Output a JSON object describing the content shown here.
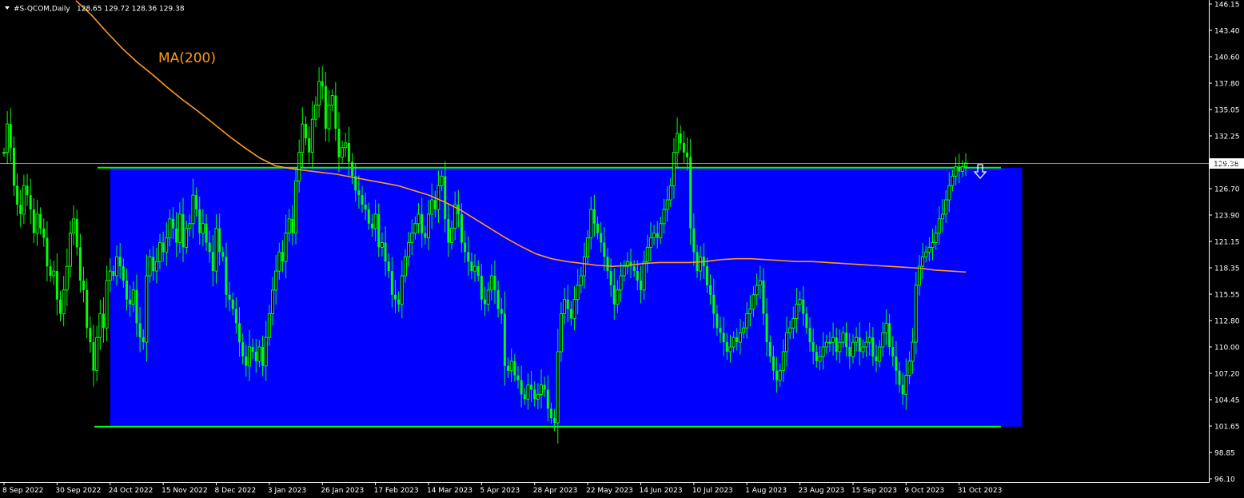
{
  "header": {
    "symbol": "#S-QCOM,Daily",
    "ohlc": "128.65 129.72 128.36 129.38"
  },
  "colors": {
    "background": "#000000",
    "axis": "#ffffff",
    "candle": "#00ff00",
    "channel_fill": "#0000ff",
    "channel_line": "#00ff00",
    "ma_line": "#ff9a1e",
    "price_line": "#c0c0c0"
  },
  "chart_data": {
    "type": "candlestick",
    "ma_label": "MA(200)",
    "current_price": 129.38,
    "current_price_label": "129.38",
    "ylim": [
      96.1,
      146.15
    ],
    "y_ticks": [
      "146.15",
      "143.40",
      "140.60",
      "137.80",
      "135.05",
      "132.25",
      "129.45",
      "126.70",
      "123.90",
      "121.15",
      "118.35",
      "115.55",
      "112.80",
      "110.00",
      "107.20",
      "104.45",
      "101.65",
      "98.85",
      "96.10"
    ],
    "x_ticks": [
      "8 Sep 2022",
      "30 Sep 2022",
      "24 Oct 2022",
      "15 Nov 2022",
      "8 Dec 2022",
      "3 Jan 2023",
      "26 Jan 2023",
      "17 Feb 2023",
      "14 Mar 2023",
      "5 Apr 2023",
      "28 Apr 2023",
      "22 May 2023",
      "14 Jun 2023",
      "10 Jul 2023",
      "1 Aug 2023",
      "23 Aug 2023",
      "15 Sep 2023",
      "9 Oct 2023",
      "31 Oct 2023"
    ],
    "x_tick_bar_index": [
      0,
      16,
      32,
      48,
      64,
      80,
      96,
      112,
      128,
      144,
      160,
      176,
      192,
      208,
      224,
      240,
      256,
      272,
      288
    ],
    "channel": {
      "upper": 128.9,
      "lower": 101.6,
      "start_bar": 32,
      "end_bar": 307
    },
    "bars_total": 302,
    "close": [
      130.5,
      133.5,
      131.0,
      127.0,
      125.0,
      124.0,
      127.0,
      126.0,
      124.5,
      122.0,
      124.0,
      122.5,
      121.5,
      118.5,
      117.5,
      118.0,
      115.0,
      113.5,
      116.0,
      118.5,
      122.0,
      123.5,
      120.5,
      117.0,
      116.0,
      112.0,
      110.5,
      107.5,
      111.0,
      113.5,
      112.0,
      117.0,
      118.0,
      117.5,
      119.5,
      118.5,
      117.0,
      115.0,
      114.5,
      116.0,
      112.5,
      111.0,
      110.5,
      117.5,
      119.5,
      118.0,
      119.0,
      121.0,
      120.0,
      121.5,
      123.5,
      122.5,
      121.0,
      124.0,
      120.5,
      122.5,
      123.0,
      126.0,
      124.5,
      122.0,
      123.0,
      121.0,
      120.0,
      118.0,
      122.5,
      120.0,
      119.5,
      115.5,
      115.0,
      114.0,
      112.5,
      110.5,
      109.0,
      108.0,
      110.0,
      109.5,
      108.5,
      110.0,
      108.0,
      111.0,
      113.5,
      116.0,
      118.0,
      120.0,
      119.0,
      122.0,
      123.5,
      122.0,
      127.5,
      130.5,
      133.5,
      132.0,
      130.5,
      134.0,
      135.5,
      138.0,
      137.5,
      133.0,
      135.5,
      136.5,
      133.0,
      130.0,
      131.0,
      131.5,
      129.5,
      128.0,
      126.5,
      126.0,
      125.0,
      124.5,
      123.0,
      122.5,
      124.0,
      120.5,
      121.0,
      119.0,
      118.0,
      115.5,
      115.0,
      114.5,
      117.5,
      119.5,
      121.0,
      122.0,
      123.0,
      124.0,
      122.0,
      121.5,
      124.0,
      125.5,
      124.5,
      127.0,
      128.0,
      123.5,
      121.0,
      122.5,
      125.0,
      124.0,
      121.0,
      120.0,
      119.0,
      118.0,
      118.5,
      117.5,
      115.0,
      114.5,
      116.0,
      117.5,
      116.0,
      114.0,
      113.5,
      108.0,
      107.5,
      108.5,
      107.0,
      106.5,
      105.0,
      104.5,
      106.0,
      105.5,
      104.5,
      105.0,
      106.0,
      105.5,
      103.5,
      102.5,
      102.0,
      109.5,
      113.5,
      115.0,
      114.0,
      113.0,
      115.0,
      116.5,
      117.5,
      119.5,
      121.5,
      124.5,
      123.0,
      122.0,
      121.0,
      119.5,
      118.0,
      116.5,
      114.5,
      116.0,
      117.5,
      118.5,
      119.0,
      118.5,
      118.0,
      117.0,
      116.0,
      119.0,
      120.5,
      121.5,
      122.0,
      121.5,
      123.0,
      124.5,
      125.5,
      127.0,
      130.5,
      132.5,
      131.5,
      130.5,
      130.0,
      122.5,
      120.0,
      118.0,
      119.5,
      118.5,
      116.5,
      115.5,
      113.5,
      112.0,
      111.5,
      110.5,
      109.5,
      110.0,
      111.0,
      110.5,
      111.5,
      112.0,
      113.5,
      114.0,
      115.5,
      116.5,
      117.0,
      113.5,
      110.5,
      109.0,
      107.5,
      106.5,
      107.5,
      109.5,
      111.5,
      112.0,
      113.0,
      114.5,
      115.0,
      113.5,
      112.0,
      110.5,
      109.5,
      108.5,
      109.0,
      110.0,
      110.5,
      110.5,
      111.0,
      109.5,
      110.5,
      111.5,
      110.0,
      109.0,
      110.5,
      111.0,
      109.5,
      110.0,
      110.5,
      111.0,
      109.0,
      108.5,
      110.0,
      111.5,
      112.5,
      110.0,
      109.0,
      107.5,
      106.0,
      105.0,
      107.0,
      108.5,
      110.5,
      116.5,
      118.5,
      119.5,
      120.0,
      120.5,
      121.0,
      122.0,
      123.5,
      124.0,
      125.5,
      127.0,
      128.0,
      129.0,
      128.5,
      129.0,
      129.38
    ],
    "ma200": [
      146.5,
      145.0,
      143.2,
      141.5,
      140.0,
      138.7,
      137.3,
      136.0,
      134.8,
      133.5,
      132.2,
      131.0,
      129.9,
      129.1,
      128.8,
      128.6,
      128.4,
      128.2,
      127.9,
      127.6,
      127.3,
      127.0,
      126.5,
      126.0,
      125.3,
      124.5,
      123.5,
      122.5,
      121.5,
      120.6,
      119.8,
      119.3,
      119.0,
      118.8,
      118.6,
      118.5,
      118.6,
      118.8,
      118.9,
      118.9,
      118.9,
      119.0,
      119.2,
      119.3,
      119.3,
      119.2,
      119.1,
      119.0,
      119.0,
      118.9,
      118.8,
      118.7,
      118.6,
      118.5,
      118.4,
      118.3,
      118.1,
      118.0,
      117.9
    ]
  }
}
